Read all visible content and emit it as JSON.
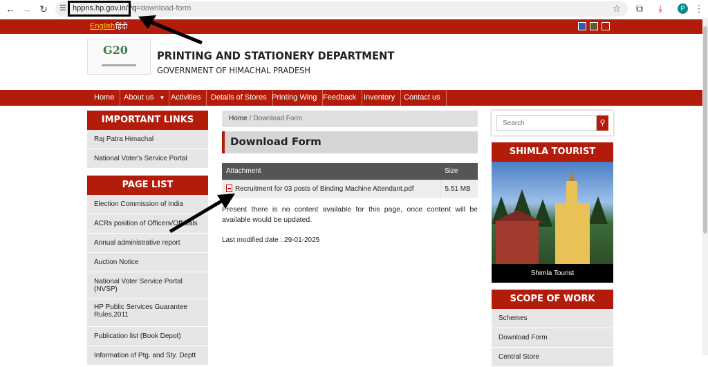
{
  "browser": {
    "url_host": "hppns.hp.gov.in/?q",
    "url_path": "=download-form",
    "profile_initial": "P"
  },
  "topbar": {
    "lang_english": "English",
    "lang_hindi": "हिंदी",
    "swatch_colors": [
      "#2a5ea8",
      "#5a5a3a",
      "#b31b0b"
    ]
  },
  "header": {
    "logo_text": "G20",
    "title": "PRINTING AND STATIONERY DEPARTMENT",
    "subtitle": "GOVERNMENT OF HIMACHAL PRADESH"
  },
  "nav": {
    "items": [
      "Home",
      "About us",
      "Activities",
      "Details of Stores",
      "Printing Wing",
      "Feedback",
      "Inventory",
      "Contact us"
    ]
  },
  "important_links": {
    "heading": "IMPORTANT LINKS",
    "items": [
      "Raj Patra Himachal",
      "National Voter's Service Portal"
    ]
  },
  "page_list": {
    "heading": "PAGE LIST",
    "items": [
      "Election Commission of India",
      "ACRs position of Officers/Officials",
      "Annual administrative report",
      "Auction Notice",
      "National Voter Service Portal (NVSP)",
      "HP Public Services Guarantee Rules,2011",
      "Publication list (Book Depot)",
      "Information of Ptg. and Sty. Deptt"
    ]
  },
  "content": {
    "breadcrumb_home": "Home",
    "breadcrumb_sep": "/",
    "breadcrumb_current": "Download Form",
    "heading": "Download Form",
    "table_headers": [
      "Attachment",
      "Size"
    ],
    "rows": [
      {
        "attachment": "Recruitment for 03 posts of Binding Machine Attendant.pdf",
        "size": "5.51 MB"
      }
    ],
    "notice": "Present there is no content available for this page, once content will be available would be updated.",
    "modified": "Last modified date : 29-01-2025"
  },
  "sidebar_right": {
    "search_placeholder": "Search",
    "tourist_heading": "SHIMLA TOURIST",
    "tourist_caption": "Shimla Tourist",
    "scope_heading": "SCOPE OF WORK",
    "scope_items": [
      "Schemes",
      "Download Form",
      "Central Store"
    ]
  },
  "colors": {
    "brand_red": "#b31b0b",
    "link_gold": "#ffd700"
  }
}
